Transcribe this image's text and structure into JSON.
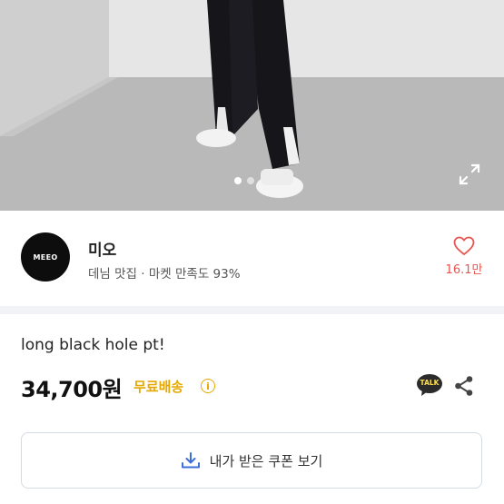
{
  "gallery": {
    "page_index": 1,
    "page_count": 2,
    "expand_icon": "expand-icon"
  },
  "seller": {
    "avatar_text": "MEEO",
    "name": "미오",
    "meta": "데님 맛집 · 마켓 만족도 93%",
    "like_count": "16.1만",
    "like_icon": "heart-outline-icon",
    "accent": "#e8544f"
  },
  "product": {
    "title": "long black hole pt!",
    "price": "34,700원",
    "shipping": "무료배송",
    "shipping_color": "#e6a800",
    "info_icon_text": "i",
    "talk_icon_text": "TALK"
  },
  "coupon": {
    "label": "내가 받은 쿠폰 보기",
    "icon": "download-icon"
  }
}
